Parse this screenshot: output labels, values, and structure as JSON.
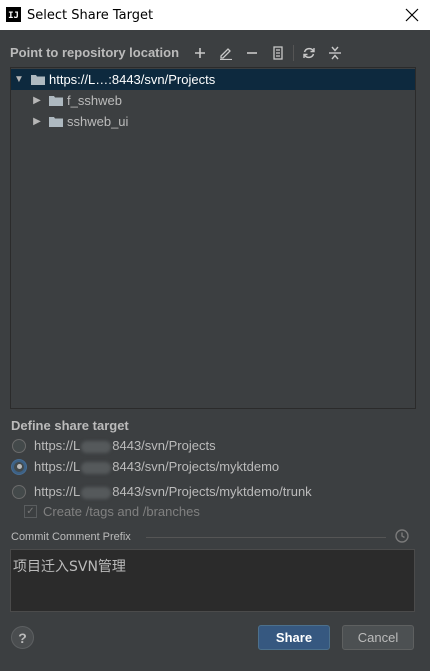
{
  "window": {
    "title": "Select Share Target",
    "app_icon_text": "IJ"
  },
  "toolbar": {
    "header": "Point to repository location",
    "icons": [
      "add-icon",
      "edit-icon",
      "remove-icon",
      "browse-icon",
      "refresh-icon",
      "collapse-icon"
    ]
  },
  "tree": {
    "root": {
      "label": "https://L…:8443/svn/Projects",
      "expanded": true
    },
    "children": [
      {
        "label": "f_sshweb"
      },
      {
        "label": "sshweb_ui"
      }
    ]
  },
  "share_target": {
    "header": "Define share target",
    "options": [
      {
        "prefix": "https://L",
        "suffix": "8443/svn/Projects",
        "checked": false
      },
      {
        "prefix": "https://L",
        "suffix": "8443/svn/Projects/myktdemo",
        "checked": true
      },
      {
        "prefix": "https://L",
        "suffix": "8443/svn/Projects/myktdemo/trunk",
        "checked": false
      }
    ],
    "create_tags_label": "Create /tags and /branches"
  },
  "commit": {
    "label": "Commit Comment Prefix",
    "value": "项目迁入SVN管理"
  },
  "buttons": {
    "help": "?",
    "share": "Share",
    "cancel": "Cancel"
  },
  "colors": {
    "background": "#3c3f41",
    "selection": "#0d293e",
    "accent": "#365880"
  }
}
